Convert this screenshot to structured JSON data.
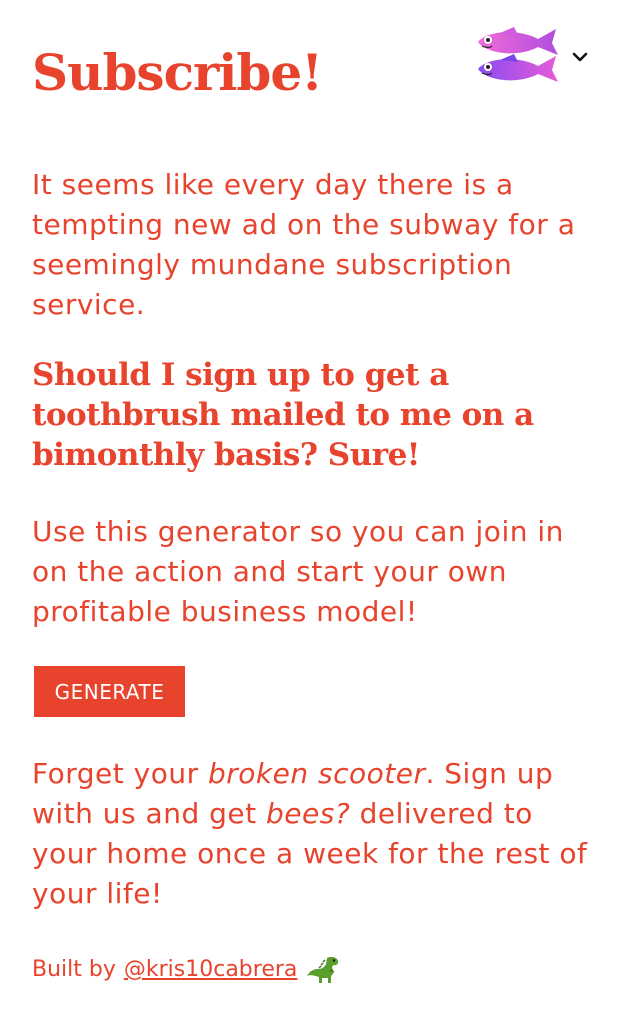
{
  "header": {
    "title": "Subscribe!"
  },
  "intro": {
    "text": "It seems like every day there is a tempting new ad on the subway for a seemingly mundane subscription service."
  },
  "question": {
    "text": "Should I sign up to get a toothbrush mailed to me on a bimonthly basis? Sure!"
  },
  "cta": {
    "text": "Use this generator so you can join in on the action and start your own profitable business model!"
  },
  "generate_button": {
    "label": "GENERATE"
  },
  "result": {
    "part1": "Forget your ",
    "old_item": "broken scooter",
    "part2": ". Sign up with us and get ",
    "new_item": "bees?",
    "part3": " delivered to your home once a week for the rest of your life!"
  },
  "footer": {
    "built_by": "Built by",
    "handle": "@kris10cabrera"
  },
  "icons": {
    "logo": "pisces-fish-icon",
    "menu": "chevron-down-icon",
    "footer": "dinosaur-icon"
  },
  "colors": {
    "accent": "#e8432d",
    "background": "#ffffff",
    "button_text": "#ffffff"
  }
}
